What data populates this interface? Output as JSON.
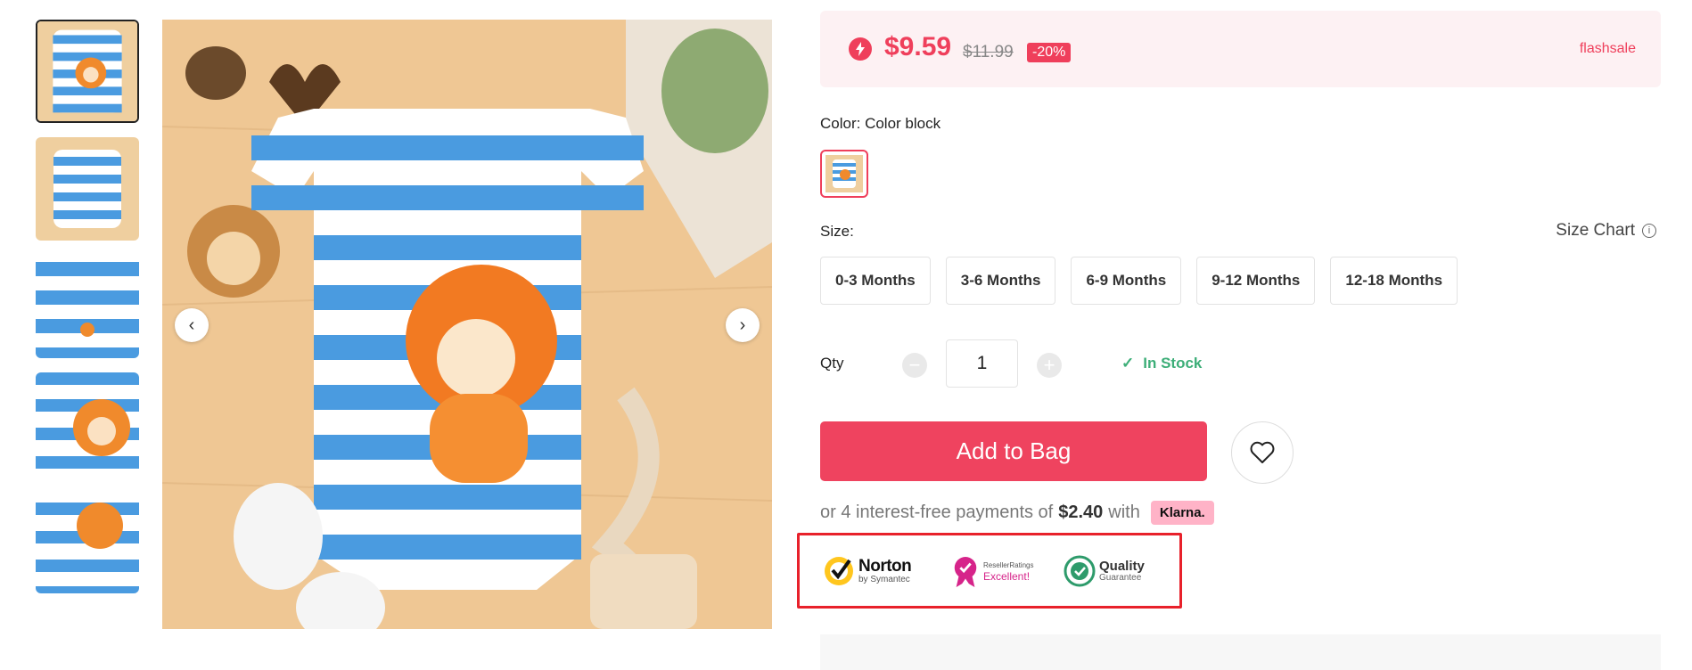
{
  "gallery": {
    "thumbnails": [
      "thumb-1",
      "thumb-2",
      "thumb-3",
      "thumb-4",
      "thumb-5"
    ],
    "prev_icon": "chevron-left-icon",
    "next_icon": "chevron-right-icon",
    "prev_label": "‹",
    "next_label": "›"
  },
  "price_box": {
    "price": "$9.59",
    "original_price": "$11.99",
    "discount": "-20%",
    "flashsale_label": "flashsale",
    "accent_color": "#ef3f5b"
  },
  "color": {
    "label": "Color: Color block"
  },
  "size": {
    "label": "Size:",
    "chart_label": "Size Chart",
    "info_glyph": "i",
    "options": [
      "0-3 Months",
      "3-6 Months",
      "6-9 Months",
      "9-12 Months",
      "12-18 Months"
    ]
  },
  "quantity": {
    "label": "Qty",
    "minus": "−",
    "plus": "+",
    "value": "1",
    "stock_status": "In Stock",
    "stock_check": "✓"
  },
  "actions": {
    "add_to_bag": "Add to Bag",
    "wishlist_icon": "heart-icon"
  },
  "payment": {
    "prefix": "or 4 interest-free payments of",
    "amount": "$2.40",
    "with": "with",
    "provider": "Klarna."
  },
  "trust_badges": {
    "norton_title": "Norton",
    "norton_sub": "by Symantec",
    "reseller_title": "ResellerRatings",
    "reseller_sub": "Excellent!",
    "quality_title": "Quality",
    "quality_sub": "Guarantee"
  }
}
